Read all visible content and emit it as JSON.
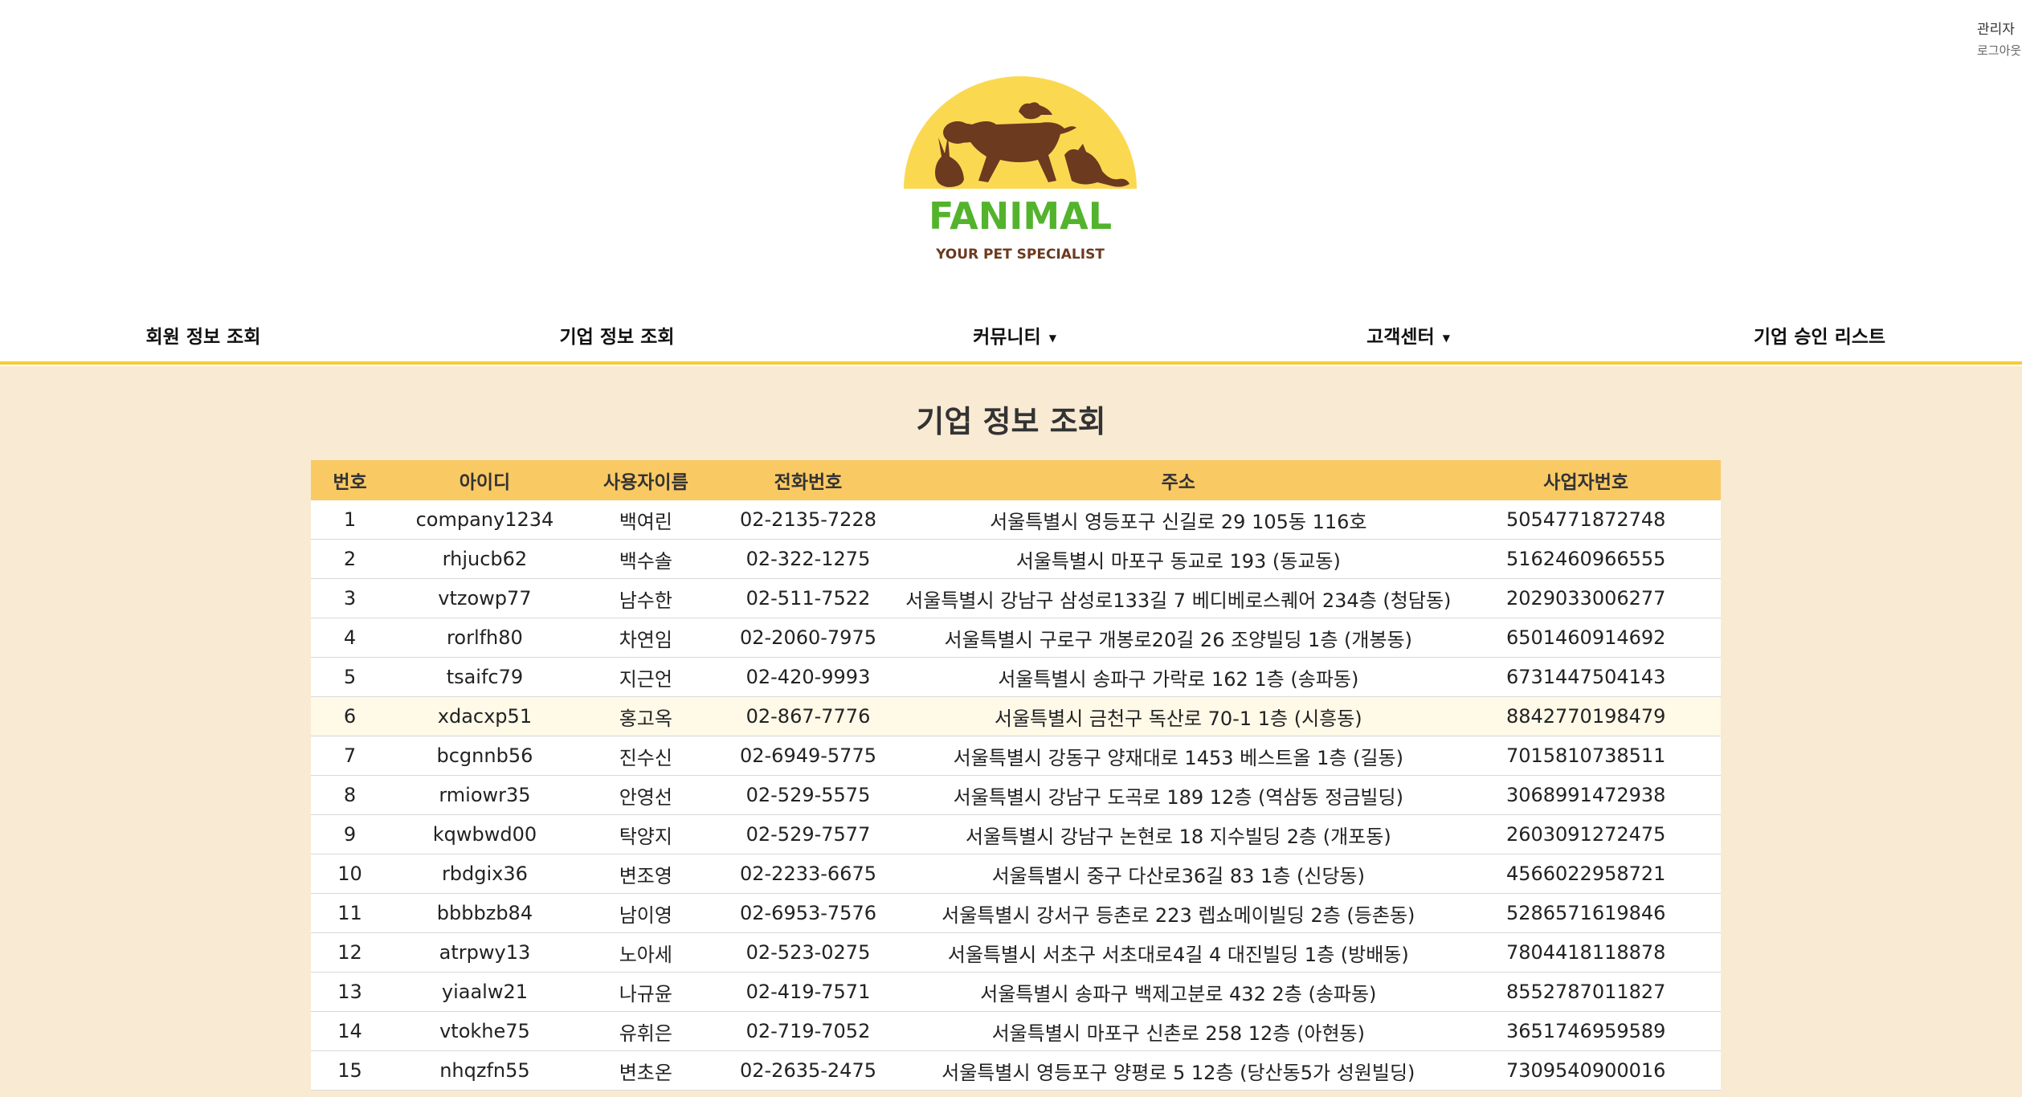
{
  "admin": {
    "label": "관리자",
    "logout": "로그아웃"
  },
  "logo": {
    "brand": "FANIMAL",
    "tagline": "YOUR PET SPECIALIST"
  },
  "nav": {
    "member_info": "회원 정보 조회",
    "company_info": "기업 정보 조회",
    "community": "커뮤니티",
    "customer_center": "고객센터",
    "company_approval": "기업 승인 리스트"
  },
  "page": {
    "title": "기업 정보 조회"
  },
  "table": {
    "headers": [
      "번호",
      "아이디",
      "사용자이름",
      "전화번호",
      "주소",
      "사업자번호"
    ],
    "rows": [
      [
        "1",
        "company1234",
        "백여린",
        "02-2135-7228",
        "서울특별시 영등포구 신길로 29 105동 116호",
        "5054771872748"
      ],
      [
        "2",
        "rhjucb62",
        "백수솔",
        "02-322-1275",
        "서울특별시 마포구 동교로 193 (동교동)",
        "5162460966555"
      ],
      [
        "3",
        "vtzowp77",
        "남수한",
        "02-511-7522",
        "서울특별시 강남구 삼성로133길 7 베디베로스퀘어 234층 (청담동)",
        "2029033006277"
      ],
      [
        "4",
        "rorlfh80",
        "차연임",
        "02-2060-7975",
        "서울특별시 구로구 개봉로20길 26 조양빌딩 1층 (개봉동)",
        "6501460914692"
      ],
      [
        "5",
        "tsaifc79",
        "지근언",
        "02-420-9993",
        "서울특별시 송파구 가락로 162 1층 (송파동)",
        "6731447504143"
      ],
      [
        "6",
        "xdacxp51",
        "홍고옥",
        "02-867-7776",
        "서울특별시 금천구 독산로 70-1 1층 (시흥동)",
        "8842770198479"
      ],
      [
        "7",
        "bcgnnb56",
        "진수신",
        "02-6949-5775",
        "서울특별시 강동구 양재대로 1453 베스트올 1층 (길동)",
        "7015810738511"
      ],
      [
        "8",
        "rmiowr35",
        "안영선",
        "02-529-5575",
        "서울특별시 강남구 도곡로 189 12층 (역삼동 정금빌딩)",
        "3068991472938"
      ],
      [
        "9",
        "kqwbwd00",
        "탁양지",
        "02-529-7577",
        "서울특별시 강남구 논현로 18 지수빌딩 2층 (개포동)",
        "2603091272475"
      ],
      [
        "10",
        "rbdgix36",
        "변조영",
        "02-2233-6675",
        "서울특별시 중구 다산로36길 83 1층 (신당동)",
        "4566022958721"
      ],
      [
        "11",
        "bbbbzb84",
        "남이영",
        "02-6953-7576",
        "서울특별시 강서구 등촌로 223 렙쇼메이빌딩 2층 (등촌동)",
        "5286571619846"
      ],
      [
        "12",
        "atrpwy13",
        "노아세",
        "02-523-0275",
        "서울특별시 서초구 서초대로4길 4 대진빌딩 1층 (방배동)",
        "7804418118878"
      ],
      [
        "13",
        "yiaalw21",
        "나규윤",
        "02-419-7571",
        "서울특별시 송파구 백제고분로 432 2층 (송파동)",
        "8552787011827"
      ],
      [
        "14",
        "vtokhe75",
        "유휘은",
        "02-719-7052",
        "서울특별시 마포구 신촌로 258 12층 (아현동)",
        "3651746959589"
      ],
      [
        "15",
        "nhqzfn55",
        "변초온",
        "02-2635-2475",
        "서울특별시 영등포구 양평로 5 12층 (당산동5가 성원빌딩)",
        "7309540900016"
      ]
    ]
  },
  "colors": {
    "accent": "#f5cc38",
    "header_row": "#f9c964",
    "background": "#f9ead4",
    "logo_sun": "#fad951",
    "logo_animals": "#6b3a1f",
    "brand_green": "#53b32d",
    "tagline_brown": "#6b3a1f"
  }
}
